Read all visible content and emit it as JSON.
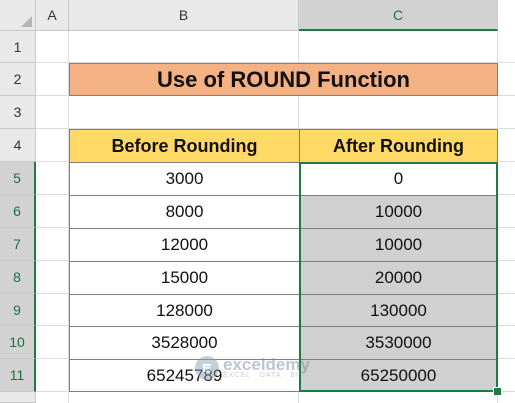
{
  "columns": [
    "A",
    "B",
    "C"
  ],
  "rows": [
    "1",
    "2",
    "3",
    "4",
    "5",
    "6",
    "7",
    "8",
    "9",
    "10",
    "11"
  ],
  "title": "Use of ROUND Function",
  "table": {
    "headers": [
      "Before Rounding",
      "After Rounding"
    ],
    "before": [
      "3000",
      "8000",
      "12000",
      "15000",
      "128000",
      "3528000",
      "65245789"
    ],
    "after": [
      "0",
      "10000",
      "10000",
      "20000",
      "130000",
      "3530000",
      "65250000"
    ]
  },
  "watermark": {
    "name": "exceldemy",
    "tagline": "EXCEL · DATA · BI"
  },
  "colors": {
    "title_fill": "#f4b183",
    "header_fill": "#ffd966",
    "selection": "#1f7a45",
    "selected_fill": "#d0d0d0"
  }
}
